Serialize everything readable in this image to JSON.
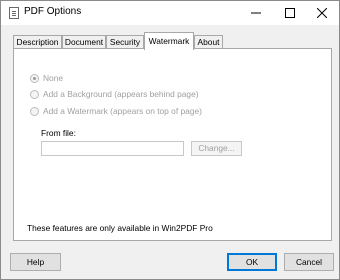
{
  "window": {
    "title": "PDF Options",
    "icon": "document-icon",
    "controls": [
      "minimize-icon",
      "maximize-icon",
      "close-icon"
    ]
  },
  "tabs": [
    {
      "label": "Description",
      "active": false
    },
    {
      "label": "Document",
      "active": false
    },
    {
      "label": "Security",
      "active": false
    },
    {
      "label": "Watermark",
      "active": true
    },
    {
      "label": "About",
      "active": false
    }
  ],
  "watermark": {
    "options": [
      {
        "label": "None",
        "selected": true,
        "enabled": false
      },
      {
        "label": "Add a Background (appears behind page)",
        "selected": false,
        "enabled": false
      },
      {
        "label": "Add a Watermark (appears on top of page)",
        "selected": false,
        "enabled": false
      }
    ],
    "from_file_label": "From file:",
    "file_value": "",
    "change_button": "Change...",
    "notice": "These features are only available in Win2PDF Pro"
  },
  "buttons": {
    "help": "Help",
    "ok": "OK",
    "cancel": "Cancel"
  }
}
